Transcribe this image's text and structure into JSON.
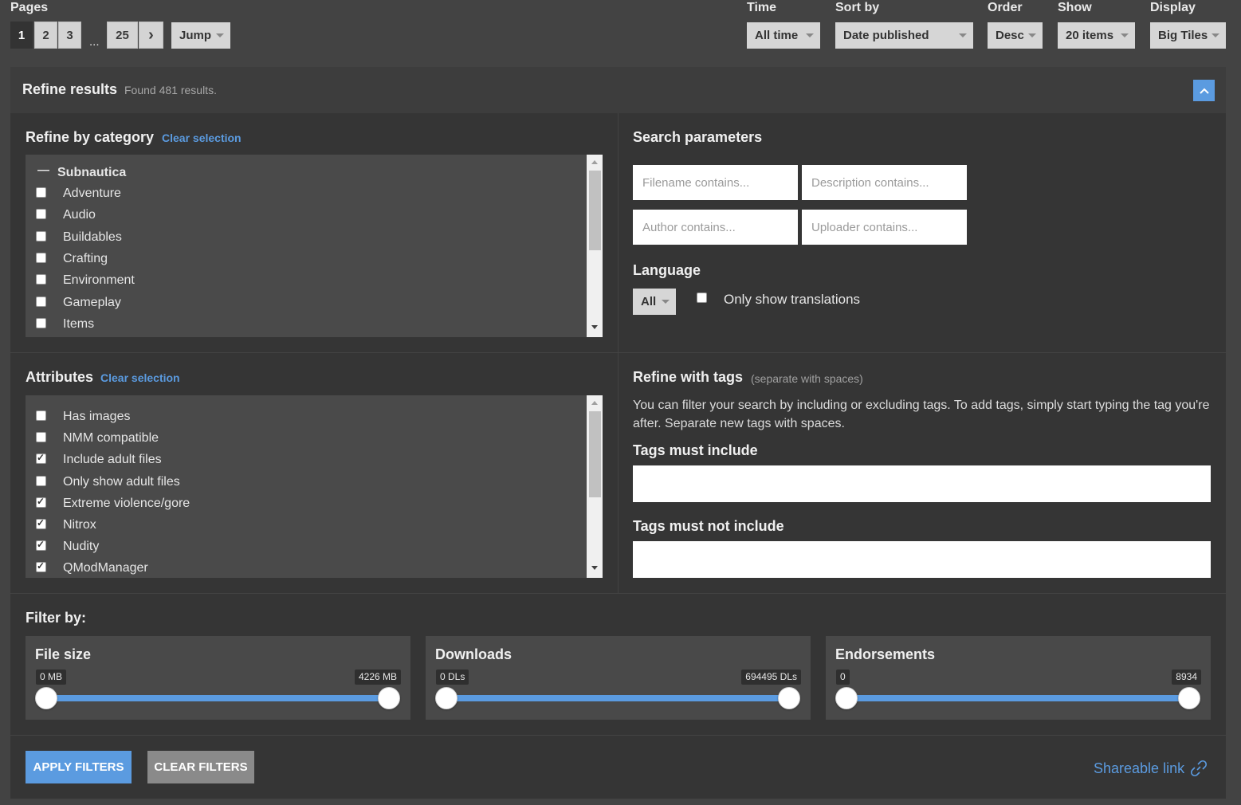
{
  "top": {
    "pages_label": "Pages",
    "pages": [
      "1",
      "2",
      "3"
    ],
    "ellipsis": "...",
    "last_page": "25",
    "next_glyph": "›",
    "jump_label": "Jump",
    "time_label": "Time",
    "time_value": "All time",
    "sort_label": "Sort by",
    "sort_value": "Date published",
    "order_label": "Order",
    "order_value": "Desc",
    "show_label": "Show",
    "show_value": "20 items",
    "display_label": "Display",
    "display_value": "Big Tiles"
  },
  "refine": {
    "title": "Refine results",
    "found": "Found 481 results."
  },
  "category": {
    "title": "Refine by category",
    "clear": "Clear selection",
    "group_toggle": "—",
    "group": "Subnautica",
    "items": [
      {
        "label": "Adventure",
        "checked": false
      },
      {
        "label": "Audio",
        "checked": false
      },
      {
        "label": "Buildables",
        "checked": false
      },
      {
        "label": "Crafting",
        "checked": false
      },
      {
        "label": "Environment",
        "checked": false
      },
      {
        "label": "Gameplay",
        "checked": false
      },
      {
        "label": "Items",
        "checked": false
      }
    ]
  },
  "search": {
    "title": "Search parameters",
    "filename_placeholder": "Filename contains...",
    "description_placeholder": "Description contains...",
    "author_placeholder": "Author contains...",
    "uploader_placeholder": "Uploader contains...",
    "language_label": "Language",
    "language_value": "All",
    "translations_label": "Only show translations"
  },
  "attributes": {
    "title": "Attributes",
    "clear": "Clear selection",
    "items": [
      {
        "label": "Has images",
        "checked": false
      },
      {
        "label": "NMM compatible",
        "checked": false
      },
      {
        "label": "Include adult files",
        "checked": true
      },
      {
        "label": "Only show adult files",
        "checked": false
      },
      {
        "label": "Extreme violence/gore",
        "checked": true
      },
      {
        "label": "Nitrox",
        "checked": true
      },
      {
        "label": "Nudity",
        "checked": true
      },
      {
        "label": "QModManager",
        "checked": true
      }
    ]
  },
  "tags": {
    "title": "Refine with tags",
    "hint": "(separate with spaces)",
    "description": "You can filter your search by including or excluding tags. To add tags, simply start typing the tag you're after. Separate new tags with spaces.",
    "include_label": "Tags must include",
    "exclude_label": "Tags must not include"
  },
  "filter": {
    "title": "Filter by:",
    "sliders": [
      {
        "name": "File size",
        "min": "0 MB",
        "max": "4226 MB"
      },
      {
        "name": "Downloads",
        "min": "0 DLs",
        "max": "694495 DLs"
      },
      {
        "name": "Endorsements",
        "min": "0",
        "max": "8934"
      }
    ]
  },
  "actions": {
    "apply": "APPLY FILTERS",
    "clear": "CLEAR FILTERS",
    "share": "Shareable link"
  },
  "colors": {
    "accent": "#5b9be0",
    "background": "#434343",
    "panel": "#353535"
  }
}
